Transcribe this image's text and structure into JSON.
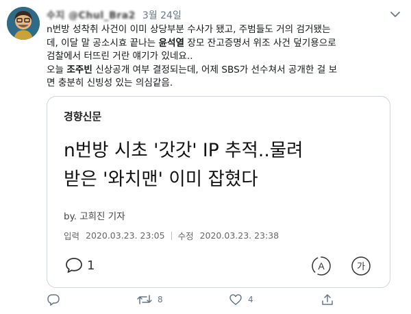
{
  "tweet": {
    "user_name": "수지 @Chul_Bra2",
    "date": "3월 24일",
    "text_lines": [
      [
        {
          "t": "n번방 성착취 사건이 이미 상당부분 수사가 됐고, 주범들도 거의 검거됐는"
        }
      ],
      [
        {
          "t": "데, 이달 말 공소시효 끝나는 "
        },
        {
          "t": "윤석열",
          "b": true
        },
        {
          "t": " 장모 잔고증명서 위조 사건 덮기용으로"
        }
      ],
      [
        {
          "t": "검찰에서 터뜨린 거란 얘기가 있네요.."
        }
      ],
      [
        {
          "t": "오늘 "
        },
        {
          "t": "조주빈",
          "b": true
        },
        {
          "t": " 신상공개 여부 결정되는데, 어제 SBS가 선수쳐서 공개한 걸 보"
        }
      ],
      [
        {
          "t": "면 충분히 신빙성 있는 의심같음."
        }
      ]
    ]
  },
  "card": {
    "publisher": "경향신문",
    "headline_line1": "n번방 시초 '갓갓' IP 추적..물려",
    "headline_line2": "받은 '와치맨' 이미 잡혔다",
    "byline": "by. 고희진 기자",
    "input_label": "입력",
    "input_date": "2020.03.23. 23:05",
    "edit_label": "수정",
    "edit_date": "2020.03.23. 23:38",
    "comment_count": "1"
  },
  "actions": {
    "reply_count": "",
    "retweet_count": "8",
    "like_count": "4"
  },
  "icons": {
    "reply": "speech-bubble-icon",
    "retweet": "retweet-icon",
    "like": "heart-icon",
    "share": "share-icon",
    "caret": "chevron-down-icon",
    "tts": "text-to-speech-icon",
    "font": "font-size-icon"
  },
  "colors": {
    "muted": "#657786",
    "border": "#ccd6dd"
  }
}
